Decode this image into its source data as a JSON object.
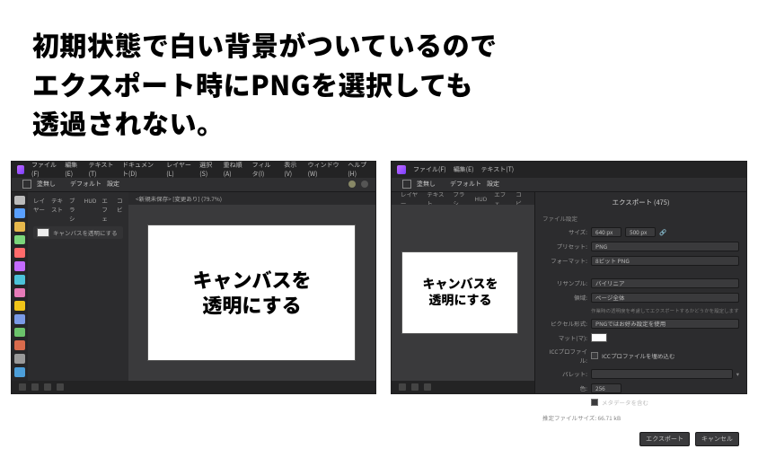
{
  "headline": {
    "line1": "初期状態で白い背景がついているので",
    "line2": "エクスポート時にPNGを選択しても",
    "line3": "透過されない。"
  },
  "leftApp": {
    "menu": [
      "ファイル(F)",
      "編集(E)",
      "テキスト(T)",
      "ドキュメント(D)",
      "レイヤー(L)",
      "選択(S)",
      "重ね順(A)",
      "フィルタ(I)",
      "表示(V)",
      "ウィンドウ(W)",
      "ヘルプ(H)"
    ],
    "subbar": {
      "label": "塗無し",
      "preset": "デフォルト",
      "set": "設定"
    },
    "context": [
      "レイヤー",
      "テキスト",
      "ブラシ",
      "HUD",
      "エフェ",
      "コビ"
    ],
    "doc_tab": "<新規未保存> [変更あり] (79.7%)",
    "side_row": "キャンバスを透明にする",
    "canvas": {
      "l1": "キャンバスを",
      "l2": "透明にする"
    },
    "tool_colors": [
      "#bbb",
      "#5aa0ff",
      "#e6b84c",
      "#7bd67b",
      "#ff6b6b",
      "#c46bff",
      "#4cc3d9",
      "#e67ab8",
      "#f0c419",
      "#7a9ae6",
      "#6bc36b",
      "#d96b4c",
      "#999",
      "#4c9ed9"
    ]
  },
  "rightApp": {
    "menu": [
      "ファイル(F)",
      "編集(E)",
      "テキスト(T)"
    ],
    "subbar": {
      "label": "塗無し",
      "preset": "デフォルト",
      "set": "設定"
    },
    "context": [
      "レイヤー",
      "テキスト",
      "ブラシ",
      "HUD",
      "エフェ",
      "コビ"
    ],
    "canvas": {
      "l1": "キャンバスを",
      "l2": "透明にする"
    },
    "export": {
      "title": "エクスポート (475)",
      "file_label": "ファイル設定",
      "size_label": "サイズ:",
      "size_w": "640 px",
      "size_h": "500 px",
      "preset_label": "プリセット:",
      "preset_value": "PNG",
      "format_label": "フォーマット:",
      "format_value": "8ビット PNG",
      "resample_label": "リサンプル:",
      "resample_value": "バイリニア",
      "area_label": "領域:",
      "area_value": "ページ全体",
      "pixel_label": "ピクセル形式:",
      "pixel_value": "PNGではお好み設定を使用",
      "hint": "作業時の透明度を考慮してエクスポートするかどうかを設定します",
      "matte_label": "マット(マ):",
      "icc_label": "ICCプロファイル:",
      "icc_check": "ICCプロファイルを埋め込む",
      "palette_label": "パレット:",
      "colors_label": "色:",
      "colors_value": "256",
      "meta_check": "メタデータを含む",
      "estimate": "推定ファイルサイズ: 66.71 kB",
      "btn_export": "エクスポート",
      "btn_cancel": "キャンセル"
    }
  }
}
